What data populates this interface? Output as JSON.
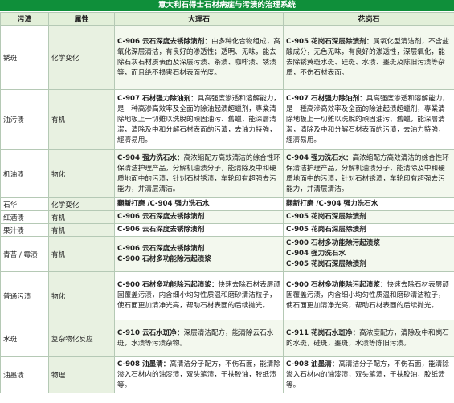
{
  "title": "意大利石得士石材病症与污渍的治理系统",
  "headers": {
    "pollutant": "污渍",
    "attribute": "属性",
    "marble": "大理石",
    "granite": "花岗石"
  },
  "rows": [
    {
      "pollutant": "锈斑",
      "attribute": "化学变化",
      "marble": {
        "product": "C-906 云石深度去锈除渍剂：",
        "desc": "由多种化合物组成，高氧化深层清洁，有良好的渗透性；透明、无味，能去除石灰石材质表面及深层污渍、茶渍、咖啡渍、锈渍等，而且绝不损害石材表面光度。"
      },
      "granite": {
        "product": "C-905 花岗石深层除渍剂：",
        "desc": "属氧化型清洁剂，不含盐酸成分，无色无味，有良好的渗透性，深层氧化，能去除锈黄斑水斑、硅斑、水渍、墨斑及陈旧污渍等杂质，不伤石材表面。"
      }
    },
    {
      "pollutant": "油污渍",
      "attribute": "有机",
      "marble": {
        "product": "C-907 石材强力除油剂：",
        "desc": "具高强度渗透和溶解能力，是一种高渗高效率及全面的除油起渍超蠟剂，專業清除地板上一切難以洗脫的頑固油污、舊蠟，能深層清潔，清除及中和分解石材表面的污漬，去油力特強，經濟易用。"
      },
      "granite": {
        "product": "C-907 石材强力除油剂：",
        "desc": "具高强度渗透和溶解能力，是一種高滲高效率及全面的除油起渍超蠟剂，專業清除地板上一切難以洗脫的頑固油污、舊蠟，能深層清潔，清除及中和分解石材表面的污漬，去油力特強，經濟易用。"
      }
    },
    {
      "pollutant": "机油渍",
      "attribute": "物化",
      "marble": {
        "product": "C-904 强力洗石水：",
        "desc": "高浓缩配方高效清洁的综合性环保清洁护理产品，分解机油渍分子，能清除及中和硬质地面中的污渍，针对石材锈渍，车轮印有超强去污能力，并清层清洁。"
      },
      "granite": {
        "product": "C-904 强力洗石水：",
        "desc": "高浓缩配方高效清洁的综合性环保清洁护理产品，分解机油渍分子，能清除及中和硬质地面中的污渍，针对石材锈渍，车轮印有超强去污能力，并清层清洁。"
      }
    },
    {
      "pollutant": "石华",
      "attribute": "化学变化",
      "marble": {
        "lines": [
          "翻新打磨 /C-904 强力洗石水"
        ]
      },
      "granite": {
        "lines": [
          "翻新打磨 /C-904 强力洗石水"
        ]
      }
    },
    {
      "pollutant": "红酒渍",
      "attribute": "有机",
      "marble": {
        "lines": [
          "C-906 云石深度去锈除渍剂"
        ]
      },
      "granite": {
        "lines": [
          "C-905 花岗石深层除渍剂"
        ]
      }
    },
    {
      "pollutant": "果汁渍",
      "attribute": "有机",
      "marble": {
        "lines": [
          "C-906 云石深度去锈除渍剂"
        ]
      },
      "granite": {
        "lines": [
          "C-905 花岗石深层除渍剂"
        ]
      }
    },
    {
      "pollutant": "青苔 / 霉渍",
      "attribute": "有机",
      "marble": {
        "lines": [
          "C-906 云石深度去锈除渍剂",
          "C-900 石材多功能除污起渍浆"
        ]
      },
      "granite": {
        "lines": [
          "C-900 石材多功能除污起渍浆",
          "C-904 强力洗石水",
          "C-905 花岗石深层除渍剂"
        ]
      }
    },
    {
      "pollutant": "普通污渍",
      "attribute": "物化",
      "marble": {
        "product": "C-900 石材多功能除污起渍浆：",
        "desc": "快速去除石材表层顽固覆盖污渍，内含细小均匀性质温和磨砂清洁粒子，使石面更加清净光亮，帮助石材表面的后续抛光。"
      },
      "granite": {
        "product": "C-900 石材多功能除污起渍浆：",
        "desc": "快速去除石材表层顽固覆盖污渍，内含细小均匀性质温和磨砂清洁粒子，使石面更加清净光亮，帮助石材表面的后续抛光。"
      }
    },
    {
      "pollutant": "水斑",
      "attribute": "复杂物化反应",
      "marble": {
        "product": "C-910 云石水斑净：",
        "desc": "深层清洁配方，能清除云石水斑，水渍等污渍杂物。"
      },
      "granite": {
        "product": "C-911 花岗石水斑净：",
        "desc": "高浓度配方，清除及中和岗石的水斑，硅斑，墨斑，水渍等陈旧污渍。"
      }
    },
    {
      "pollutant": "油墨渍",
      "attribute": "物理",
      "marble": {
        "product": "C-908 油墨清：",
        "desc": "高清洁分子配方，不伤石面，能清除渗入石材内的油漆渍，双头笔渍，干扶胶油，胶纸渍等。"
      },
      "granite": {
        "product": "C-908 油墨清：",
        "desc": "高清洁分子配方，不伤石面，能清除渗入石材内的油漆渍，双头笔渍，干扶胶油，胶纸渍等。"
      }
    }
  ]
}
